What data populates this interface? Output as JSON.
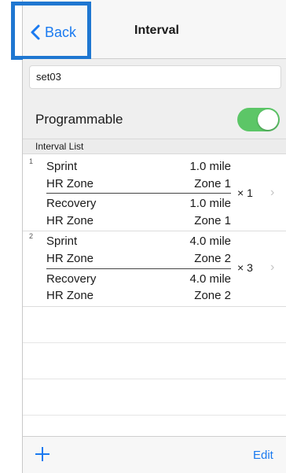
{
  "nav": {
    "back_label": "Back",
    "title": "Interval"
  },
  "name_field": {
    "value": "set03"
  },
  "programmable": {
    "label": "Programmable",
    "enabled": true
  },
  "list_header": "Interval List",
  "groups": [
    {
      "index": "1",
      "repeat": "× 1",
      "rows": [
        {
          "label": "Sprint",
          "value": "1.0 mile"
        },
        {
          "label": "HR Zone",
          "value": "Zone 1"
        },
        {
          "label": "Recovery",
          "value": "1.0 mile"
        },
        {
          "label": "HR Zone",
          "value": "Zone 1"
        }
      ]
    },
    {
      "index": "2",
      "repeat": "× 3",
      "rows": [
        {
          "label": "Sprint",
          "value": "4.0 mile"
        },
        {
          "label": "HR Zone",
          "value": "Zone 2"
        },
        {
          "label": "Recovery",
          "value": "4.0 mile"
        },
        {
          "label": "HR Zone",
          "value": "Zone 2"
        }
      ]
    }
  ],
  "toolbar": {
    "edit_label": "Edit"
  },
  "colors": {
    "accent": "#1a7af0",
    "toggle_on": "#5cc667",
    "highlight": "#1f77d1"
  },
  "icons": {
    "back": "chevron-left-icon",
    "add": "plus-icon",
    "disclosure": "chevron-right-icon"
  }
}
